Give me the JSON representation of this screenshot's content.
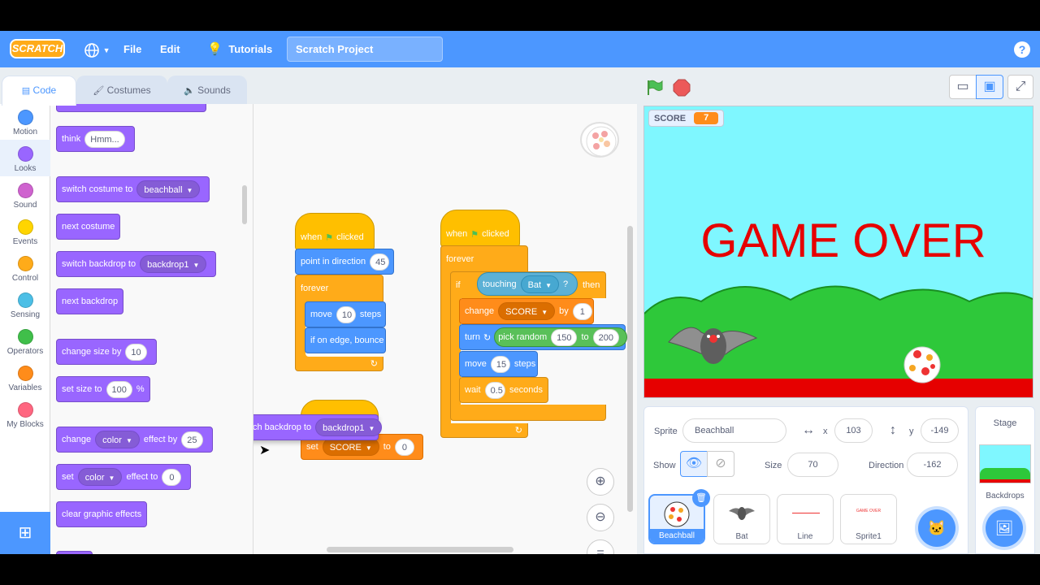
{
  "menu": {
    "logo": "SCRATCH",
    "file": "File",
    "edit": "Edit",
    "tutorials": "Tutorials",
    "project_title": "Scratch Project",
    "help": "?"
  },
  "tabs": {
    "code": "Code",
    "costumes": "Costumes",
    "sounds": "Sounds"
  },
  "categories": [
    {
      "label": "Motion",
      "color": "#4c97ff"
    },
    {
      "label": "Looks",
      "color": "#9966ff"
    },
    {
      "label": "Sound",
      "color": "#cf63cf"
    },
    {
      "label": "Events",
      "color": "#ffd500"
    },
    {
      "label": "Control",
      "color": "#ffab19"
    },
    {
      "label": "Sensing",
      "color": "#4cbfe6"
    },
    {
      "label": "Operators",
      "color": "#40bf4a"
    },
    {
      "label": "Variables",
      "color": "#ff8c1a"
    },
    {
      "label": "My Blocks",
      "color": "#ff6680"
    }
  ],
  "palette": {
    "think": "think",
    "think_val": "Hmm...",
    "switch_costume": "switch costume to",
    "costume_val": "beachball",
    "next_costume": "next costume",
    "switch_backdrop": "switch backdrop to",
    "backdrop_val": "backdrop1",
    "next_backdrop": "next backdrop",
    "change_size": "change size by",
    "change_size_val": "10",
    "set_size": "set size to",
    "set_size_val": "100",
    "percent": "%",
    "change_effect": "change",
    "effect_color": "color",
    "effect_by": "effect by",
    "effect_by_val": "25",
    "set_effect": "set",
    "effect_to": "effect to",
    "effect_to_val": "0",
    "clear_effects": "clear graphic effects"
  },
  "script1": {
    "when": "when",
    "clicked": "clicked",
    "point": "point in direction",
    "point_val": "45",
    "forever": "forever",
    "move": "move",
    "move_val": "10",
    "steps": "steps",
    "bounce": "if on edge, bounce"
  },
  "script2": {
    "when": "when",
    "clicked": "clicked",
    "forever": "forever",
    "if": "if",
    "touching": "touching",
    "touching_val": "Bat",
    "q": "?",
    "then": "then",
    "change": "change",
    "var": "SCORE",
    "by": "by",
    "by_val": "1",
    "turn": "turn",
    "pick": "pick random",
    "pick_from": "150",
    "to": "to",
    "pick_to": "200",
    "move": "move",
    "move_val": "15",
    "steps": "steps",
    "wait": "wait",
    "wait_val": "0.5",
    "seconds": "seconds"
  },
  "script3": {
    "set": "set",
    "var": "SCORE",
    "to": "to",
    "to_val": "0",
    "dragged_label": "switch backdrop to",
    "dragged_val": "backdrop1"
  },
  "stage": {
    "score_label": "SCORE",
    "score_value": "7",
    "game_over": "GAME OVER"
  },
  "sprite_info": {
    "sprite_label": "Sprite",
    "sprite_name": "Beachball",
    "x_label": "x",
    "x_val": "103",
    "y_label": "y",
    "y_val": "-149",
    "show_label": "Show",
    "size_label": "Size",
    "size_val": "70",
    "direction_label": "Direction",
    "direction_val": "-162"
  },
  "sprites": [
    {
      "name": "Beachball"
    },
    {
      "name": "Bat"
    },
    {
      "name": "Line"
    },
    {
      "name": "Sprite1",
      "thumb_text": "GAME OVER"
    }
  ],
  "stage_panel": {
    "title": "Stage",
    "backdrops": "Backdrops"
  }
}
